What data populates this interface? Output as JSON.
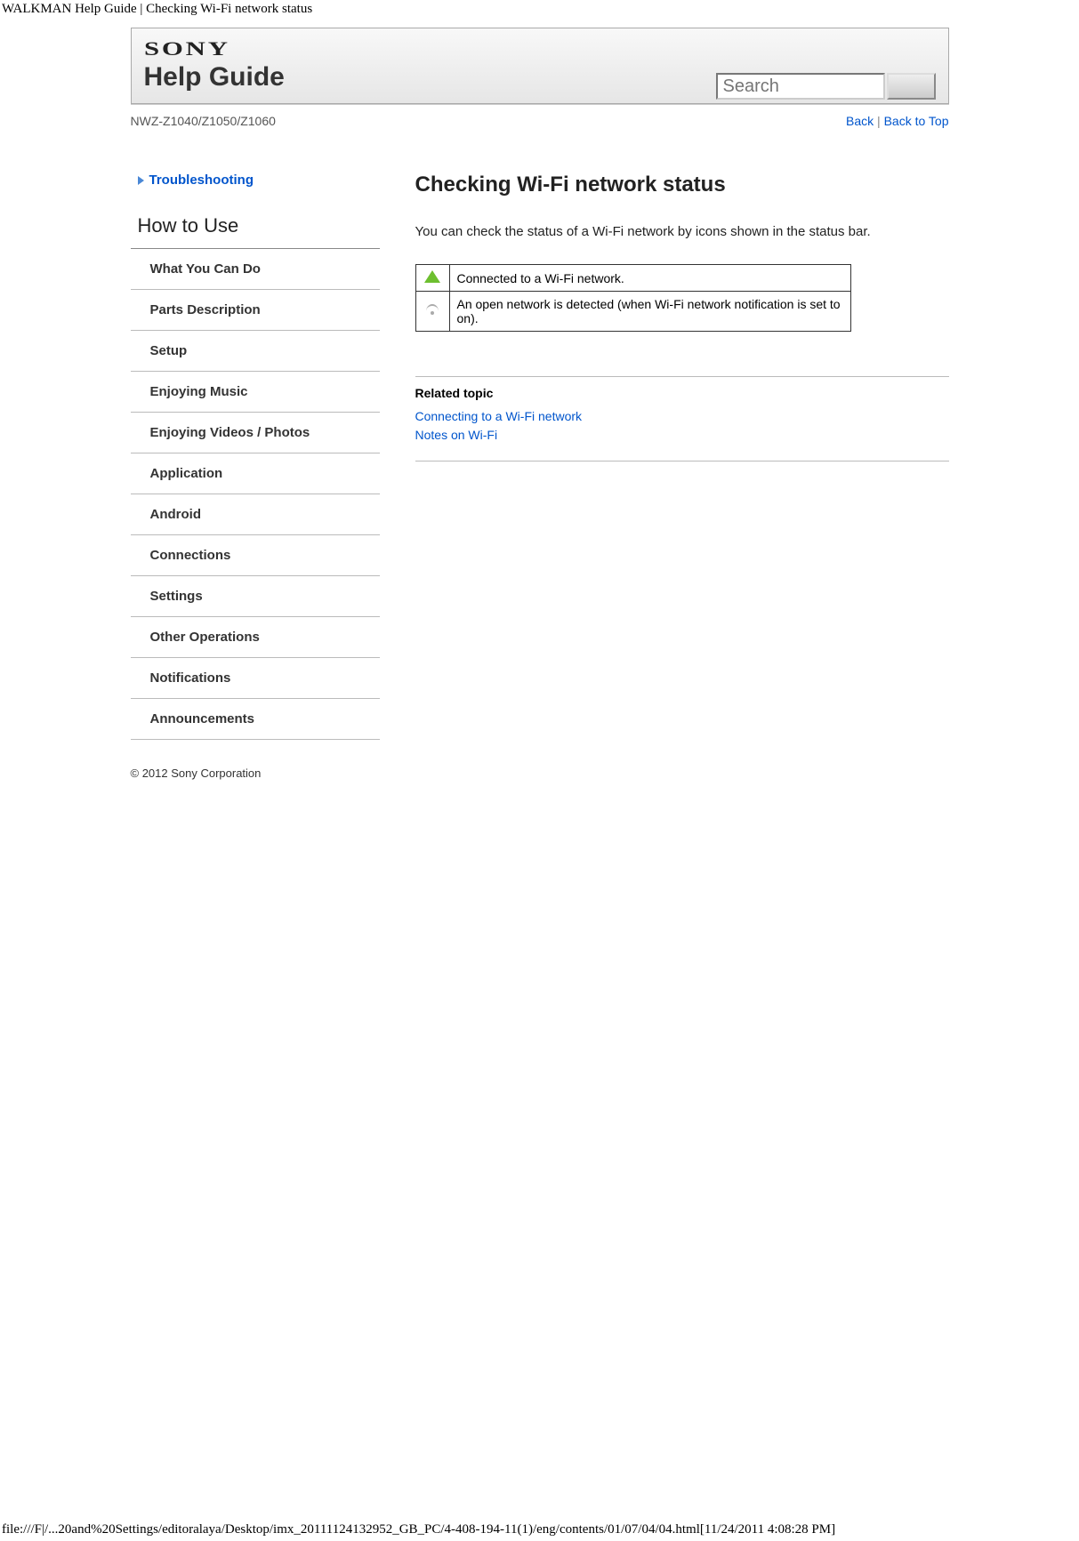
{
  "page": {
    "header_text": "WALKMAN Help Guide | Checking Wi-Fi network status",
    "footer_path": "file:///F|/...20and%20Settings/editoralaya/Desktop/imx_20111124132952_GB_PC/4-408-194-11(1)/eng/contents/01/07/04/04.html[11/24/2011 4:08:28 PM]"
  },
  "header": {
    "brand": "SONY",
    "title": "Help Guide",
    "search_placeholder": "Search"
  },
  "model_row": {
    "model": "NWZ-Z1040/Z1050/Z1060",
    "back": "Back",
    "sep": " | ",
    "back_to_top": "Back to Top"
  },
  "sidebar": {
    "troubleshooting": "Troubleshooting",
    "how_to_use": "How to Use",
    "items": [
      "What You Can Do",
      "Parts Description",
      "Setup",
      "Enjoying Music",
      "Enjoying Videos / Photos",
      "Application",
      "Android",
      "Connections",
      "Settings",
      "Other Operations",
      "Notifications",
      "Announcements"
    ]
  },
  "main": {
    "title": "Checking Wi-Fi network status",
    "paragraph": "You can check the status of a Wi-Fi network by icons shown in the status bar.",
    "table": {
      "row1": "Connected to a Wi-Fi network.",
      "row2": "An open network is detected (when Wi-Fi network notification is set to on)."
    },
    "related": {
      "heading": "Related topic",
      "links": [
        "Connecting to a Wi-Fi network",
        "Notes on Wi-Fi"
      ]
    }
  },
  "copyright": "© 2012 Sony Corporation"
}
